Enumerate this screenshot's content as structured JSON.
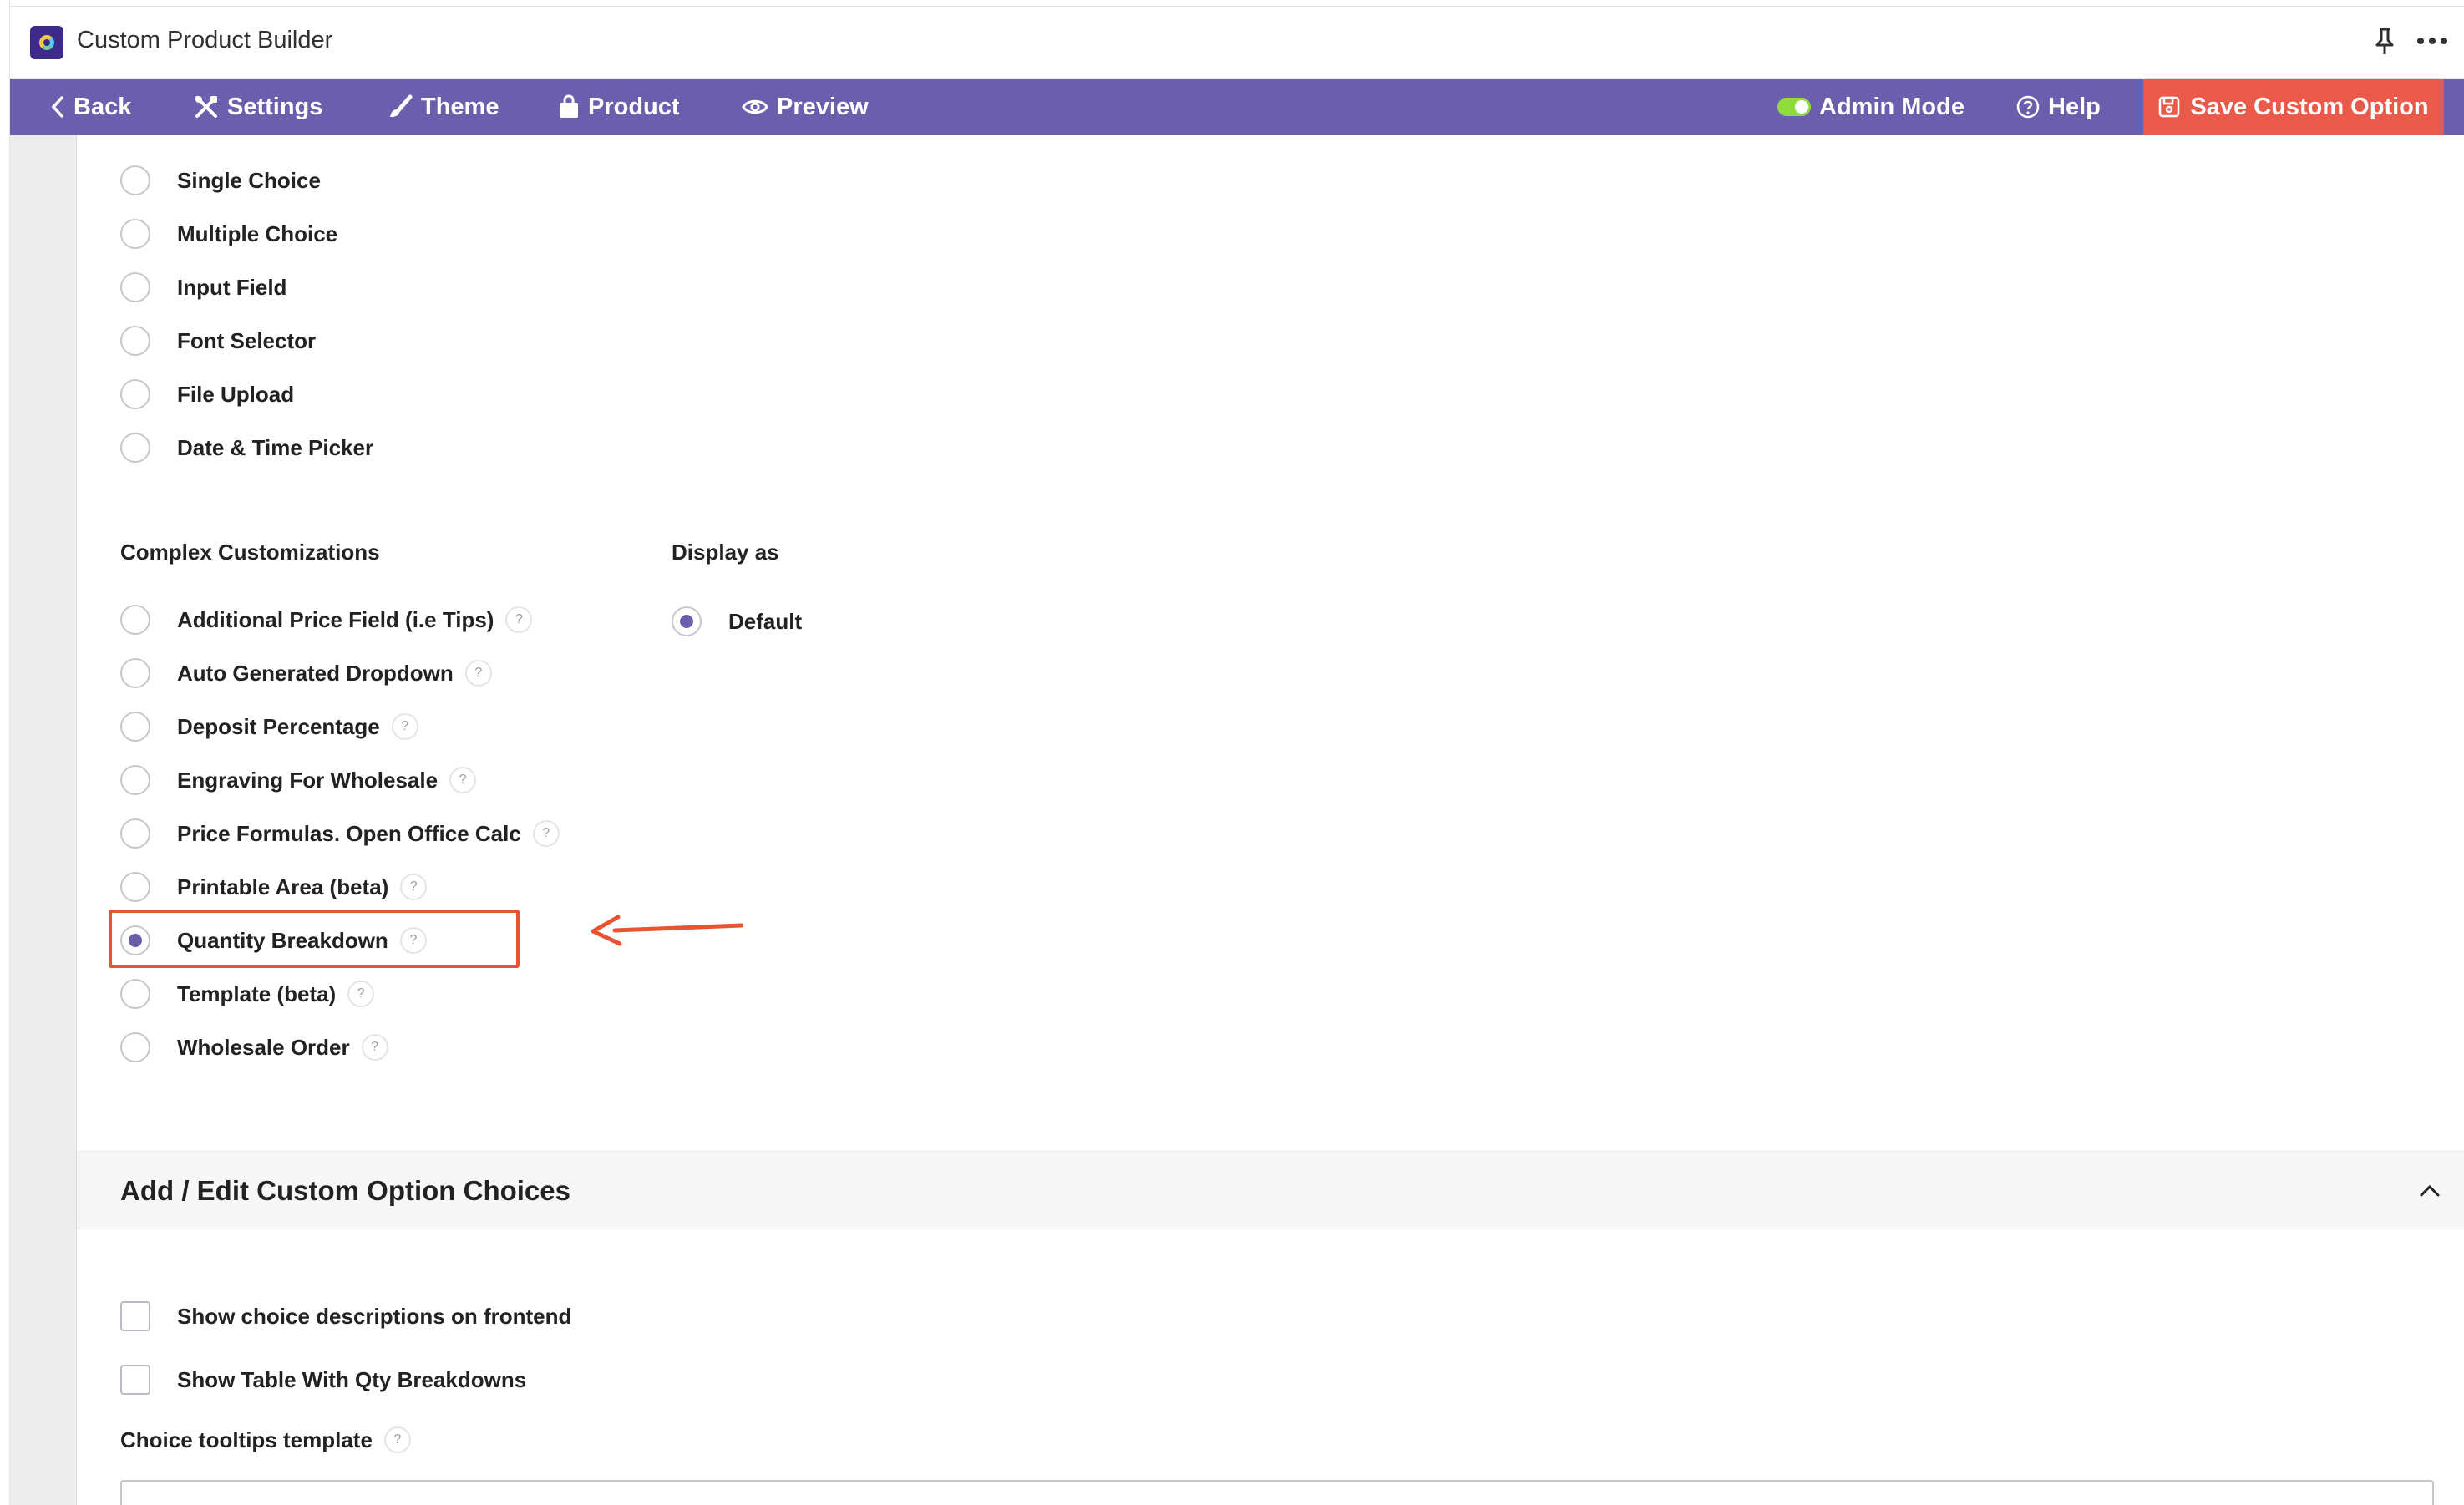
{
  "app": {
    "title": "Custom Product Builder"
  },
  "nav": {
    "back": "Back",
    "settings": "Settings",
    "theme": "Theme",
    "product": "Product",
    "preview": "Preview",
    "admin_mode": "Admin Mode",
    "help": "Help",
    "save": "Save Custom Option"
  },
  "basic_options": [
    {
      "label": "Single Choice",
      "checked": false
    },
    {
      "label": "Multiple Choice",
      "checked": false
    },
    {
      "label": "Input Field",
      "checked": false
    },
    {
      "label": "Font Selector",
      "checked": false
    },
    {
      "label": "File Upload",
      "checked": false
    },
    {
      "label": "Date & Time Picker",
      "checked": false
    }
  ],
  "complex": {
    "heading": "Complex Customizations",
    "help_glyph": "?",
    "items": [
      {
        "label": "Additional Price Field (i.e Tips)",
        "checked": false
      },
      {
        "label": "Auto Generated Dropdown",
        "checked": false
      },
      {
        "label": "Deposit Percentage",
        "checked": false
      },
      {
        "label": "Engraving For Wholesale",
        "checked": false
      },
      {
        "label": "Price Formulas. Open Office Calc",
        "checked": false
      },
      {
        "label": "Printable Area (beta)",
        "checked": false
      },
      {
        "label": "Quantity Breakdown",
        "checked": true
      },
      {
        "label": "Template (beta)",
        "checked": false
      },
      {
        "label": "Wholesale Order",
        "checked": false
      }
    ]
  },
  "display_as": {
    "heading": "Display as",
    "option": "Default",
    "checked": true
  },
  "choices_panel": {
    "title": "Add / Edit Custom Option Choices",
    "show_descriptions": "Show choice descriptions on frontend",
    "show_table": "Show Table With Qty Breakdowns",
    "tooltips_label": "Choice tooltips template",
    "tooltips_value": ""
  },
  "colors": {
    "nav_bg": "#6b5fad",
    "save_bg": "#ea5a4b",
    "toggle_on": "#8fdc3c",
    "radio_checked": "#6b5fad",
    "annotation": "#e8542f"
  }
}
